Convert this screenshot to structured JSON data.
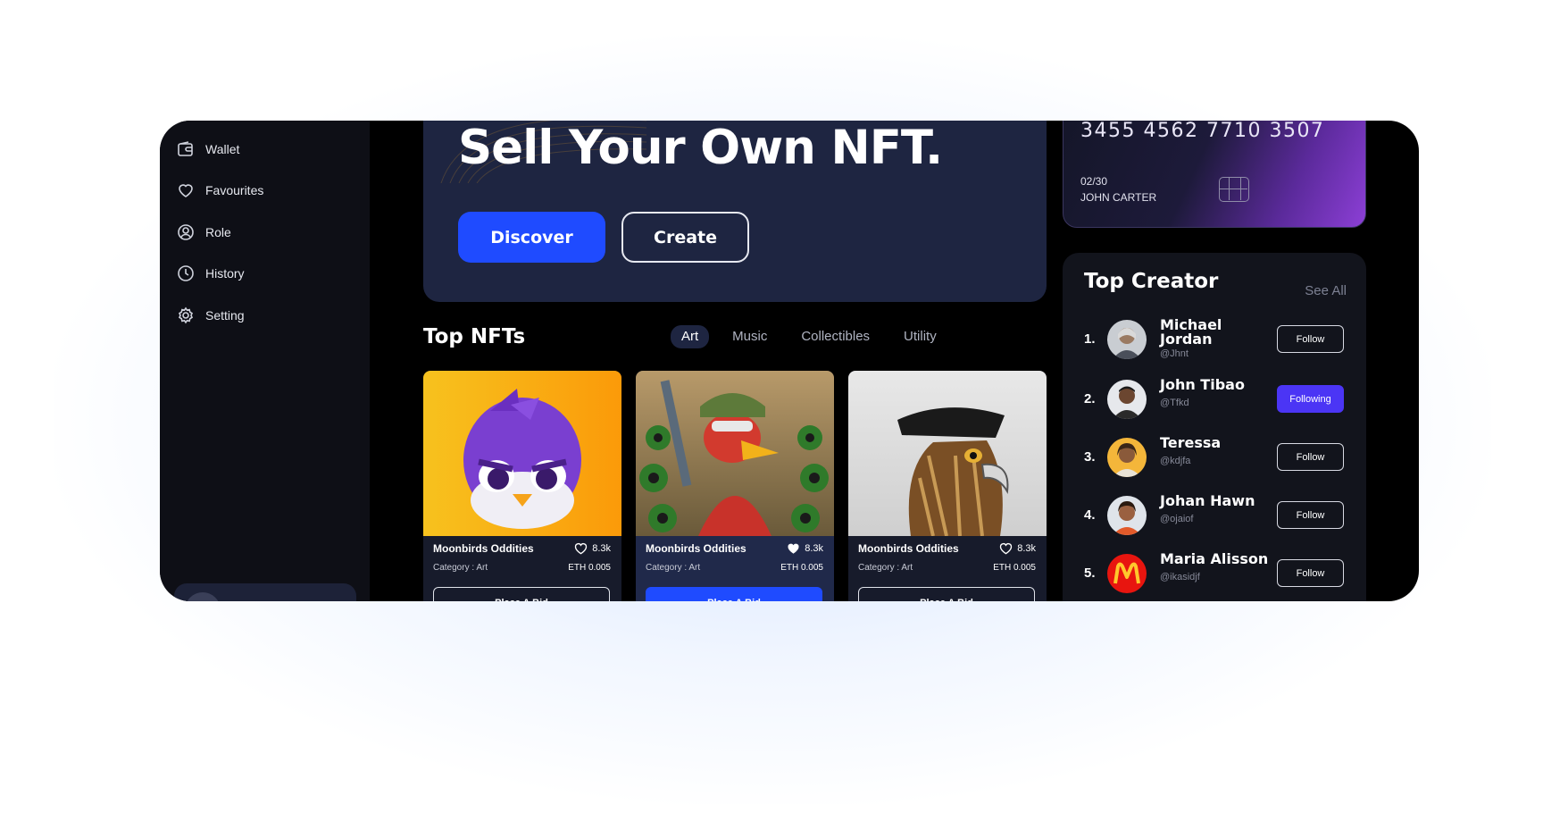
{
  "sidebar": {
    "items": [
      {
        "label": "Wallet",
        "icon": "wallet-icon"
      },
      {
        "label": "Favourites",
        "icon": "heart-icon"
      },
      {
        "label": "Role",
        "icon": "user-circle-icon"
      },
      {
        "label": "History",
        "icon": "clock-icon"
      },
      {
        "label": "Setting",
        "icon": "gear-icon"
      }
    ]
  },
  "hero": {
    "title": "Sell Your Own NFT.",
    "discover_label": "Discover",
    "create_label": "Create"
  },
  "top_nfts": {
    "title": "Top NFTs",
    "tabs": [
      "Art",
      "Music",
      "Collectibles",
      "Utility"
    ],
    "active_tab": "Art",
    "cards": [
      {
        "name": "Moonbirds Oddities",
        "likes": "8.3k",
        "category": "Category : Art",
        "price": "ETH 0.005",
        "bid_label": "Place A Bid",
        "liked": false
      },
      {
        "name": "Moonbirds Oddities",
        "likes": "8.3k",
        "category": "Category : Art",
        "price": "ETH 0.005",
        "bid_label": "Place A Bid",
        "liked": true
      },
      {
        "name": "Moonbirds Oddities",
        "likes": "8.3k",
        "category": "Category : Art",
        "price": "ETH 0.005",
        "bid_label": "Place A Bid",
        "liked": false
      }
    ]
  },
  "card": {
    "number": "3455 4562 7710 3507",
    "expiry": "02/30",
    "holder": "JOHN CARTER"
  },
  "creators": {
    "title": "Top Creator",
    "see_all": "See All",
    "list": [
      {
        "rank": "1.",
        "name": "Michael Jordan",
        "handle": "@Jhnt",
        "button": "Follow",
        "following": false
      },
      {
        "rank": "2.",
        "name": "John Tibao",
        "handle": "@Tfkd",
        "button": "Following",
        "following": true
      },
      {
        "rank": "3.",
        "name": "Teressa",
        "handle": "@kdjfa",
        "button": "Follow",
        "following": false
      },
      {
        "rank": "4.",
        "name": "Johan Hawn",
        "handle": "@ojaiof",
        "button": "Follow",
        "following": false
      },
      {
        "rank": "5.",
        "name": "Maria Alisson",
        "handle": "@ikasidjf",
        "button": "Follow",
        "following": false
      }
    ]
  },
  "colors": {
    "accent": "#1f4bff",
    "following": "#4b35f5",
    "panel": "#1e2541"
  }
}
